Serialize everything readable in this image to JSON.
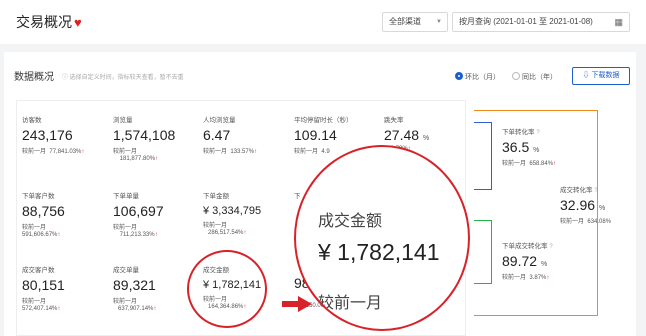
{
  "header": {
    "title": "交易概况",
    "channel": "全部渠道",
    "date_range": "按月查询 (2021-01-01 至 2021-01-08)"
  },
  "overview": {
    "title": "数据概况",
    "note": "选择自定义时间，指标较天查看，暂不去重",
    "mom": "环比（月）",
    "yoy": "同比（年）",
    "download": "下载数据"
  },
  "compare_label": "较前一月",
  "metrics": {
    "visitors": {
      "label": "访客数",
      "value": "243,176",
      "change": "77,841.03%"
    },
    "pageviews": {
      "label": "浏览量",
      "value": "1,574,108",
      "change": "181,877.80%"
    },
    "pv_per_user": {
      "label": "人均浏览量",
      "value": "6.47",
      "change": "133.57%"
    },
    "avg_stay": {
      "label": "平均停留时长（秒）",
      "value": "109.14",
      "change": "4.9"
    },
    "bounce": {
      "label": "跳失率",
      "value": "27.48",
      "unit": "%",
      "change": "189.79%"
    },
    "order_conv": {
      "label": "下单转化率",
      "value": "36.5",
      "unit": "%",
      "change": "658.84%"
    },
    "order_customers": {
      "label": "下单客户数",
      "value": "88,756",
      "change": "591,606.67%"
    },
    "order_count": {
      "label": "下单单量",
      "value": "106,697",
      "change": "711,213.33%"
    },
    "order_amount": {
      "label": "下单金额",
      "value": "¥ 3,334,795",
      "change": "286,517.54%"
    },
    "order_col4": {
      "label": "下"
    },
    "deal_conv": {
      "label": "成交转化率",
      "value": "32.96",
      "unit": "%",
      "change": "634.08%"
    },
    "deal_customers": {
      "label": "成交客户数",
      "value": "80,151",
      "change": "572,407.14%"
    },
    "deal_count": {
      "label": "成交单量",
      "value": "89,321",
      "change": "637,907.14%"
    },
    "deal_amount": {
      "label": "成交金额",
      "value": "¥ 1,782,141",
      "change": "164,364.86%"
    },
    "deal_col4": {
      "value": "98",
      "change": "706,150.00%"
    },
    "order_deal_conv": {
      "label": "下单成交转化率",
      "value": "89.72",
      "unit": "%",
      "change": "3.87%"
    }
  },
  "zoom": {
    "label": "成交金额",
    "value": "¥ 1,782,141",
    "compare": "较前一月"
  }
}
